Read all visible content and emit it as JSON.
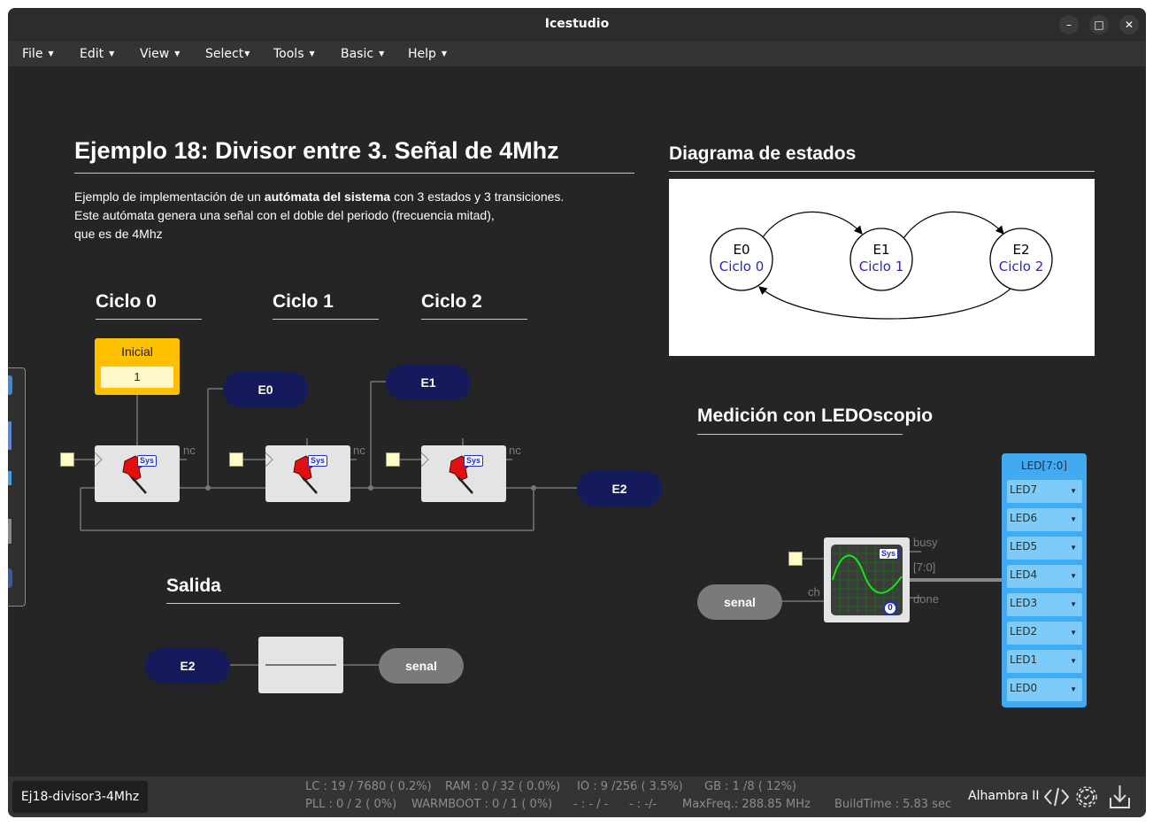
{
  "window": {
    "title": "Icestudio"
  },
  "menu": [
    {
      "label": "File"
    },
    {
      "label": "Edit"
    },
    {
      "label": "View"
    },
    {
      "label": "Select"
    },
    {
      "label": "Tools"
    },
    {
      "label": "Basic"
    },
    {
      "label": "Help"
    }
  ],
  "main": {
    "title": "Ejemplo 18: Divisor entre 3. Señal de 4Mhz",
    "desc_pre": "Ejemplo de implementación de un ",
    "desc_bold": "autómata del sistema",
    "desc_post": " con 3 estados y 3 transiciones.",
    "desc_line2": "Este autómata genera una señal con el doble del periodo (frecuencia mitad),",
    "desc_line3": "que es de 4Mhz",
    "ciclos": [
      "Ciclo 0",
      "Ciclo 1",
      "Ciclo 2"
    ],
    "inicial_label": "Inicial",
    "inicial_value": "1",
    "state_labels": [
      "E0",
      "E1",
      "E2"
    ],
    "nc": "nc",
    "sys": "Sys",
    "salida_title": "Salida",
    "salida_in": "E2",
    "salida_out": "senal"
  },
  "diagram": {
    "title": "Diagrama de estados",
    "states": [
      {
        "name": "E0",
        "sub": "Ciclo 0"
      },
      {
        "name": "E1",
        "sub": "Ciclo 1"
      },
      {
        "name": "E2",
        "sub": "Ciclo 2"
      }
    ]
  },
  "ledoscope": {
    "title": "Medición con LEDOscopio",
    "input": "senal",
    "ch": "ch",
    "busy": "busy",
    "bus": "[7:0]",
    "done": "done",
    "zero": "0",
    "led_header": "LED[7:0]",
    "leds": [
      "LED7",
      "LED6",
      "LED5",
      "LED4",
      "LED3",
      "LED2",
      "LED1",
      "LED0"
    ]
  },
  "status": {
    "project": "Ej18-divisor3-4Mhz",
    "lc": "LC : 19 / 7680 ( 0.2%)",
    "ram": "RAM : 0 / 32 ( 0.0%)",
    "io": "IO :  9 /256  ( 3.5%)",
    "gb": "GB :  1 /8  ( 12%)",
    "pll": "PLL : 0 / 2 ( 0%)",
    "warmboot": "WARMBOOT : 0 / 1 ( 0%)",
    "dash1": "- : - / -",
    "dash2": "- :  -/-",
    "maxfreq": "MaxFreq.:  288.85 MHz",
    "buildtime": "BuildTime :   5.83 sec",
    "board": "Alhambra II"
  },
  "colors": {
    "accent": "#141a5c",
    "led_panel": "#42aaf0",
    "inicial": "#ffc000"
  }
}
